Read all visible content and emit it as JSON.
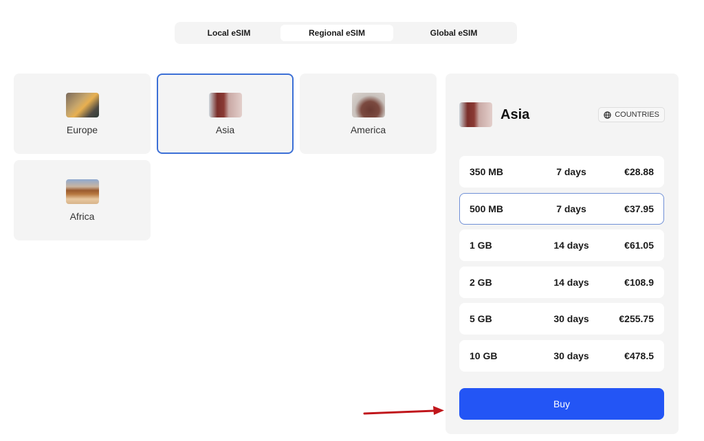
{
  "tabs": [
    {
      "label": "Local eSIM",
      "active": false
    },
    {
      "label": "Regional eSIM",
      "active": true
    },
    {
      "label": "Global eSIM",
      "active": false
    }
  ],
  "regions": [
    {
      "name": "Europe",
      "image": "europe-city-thumbnail",
      "selected": false
    },
    {
      "name": "Asia",
      "image": "asia-pagoda-thumbnail",
      "selected": true
    },
    {
      "name": "America",
      "image": "america-capitol-thumbnail",
      "selected": false
    },
    {
      "name": "Africa",
      "image": "africa-desert-rock-thumbnail",
      "selected": false
    }
  ],
  "panel": {
    "title": "Asia",
    "countries_label": "COUNTRIES",
    "countries_icon": "globe-icon",
    "plans": [
      {
        "data": "350 MB",
        "days": "7 days",
        "price": "€28.88",
        "selected": false
      },
      {
        "data": "500 MB",
        "days": "7 days",
        "price": "€37.95",
        "selected": true
      },
      {
        "data": "1 GB",
        "days": "14 days",
        "price": "€61.05",
        "selected": false
      },
      {
        "data": "2 GB",
        "days": "14 days",
        "price": "€108.9",
        "selected": false
      },
      {
        "data": "5 GB",
        "days": "30 days",
        "price": "€255.75",
        "selected": false
      },
      {
        "data": "10 GB",
        "days": "30 days",
        "price": "€478.5",
        "selected": false
      }
    ],
    "buy_label": "Buy"
  },
  "colors": {
    "accent": "#2355f5",
    "selected_border": "#3b6fd6",
    "card_bg": "#f4f4f4",
    "annotation_arrow": "#c0161b"
  }
}
